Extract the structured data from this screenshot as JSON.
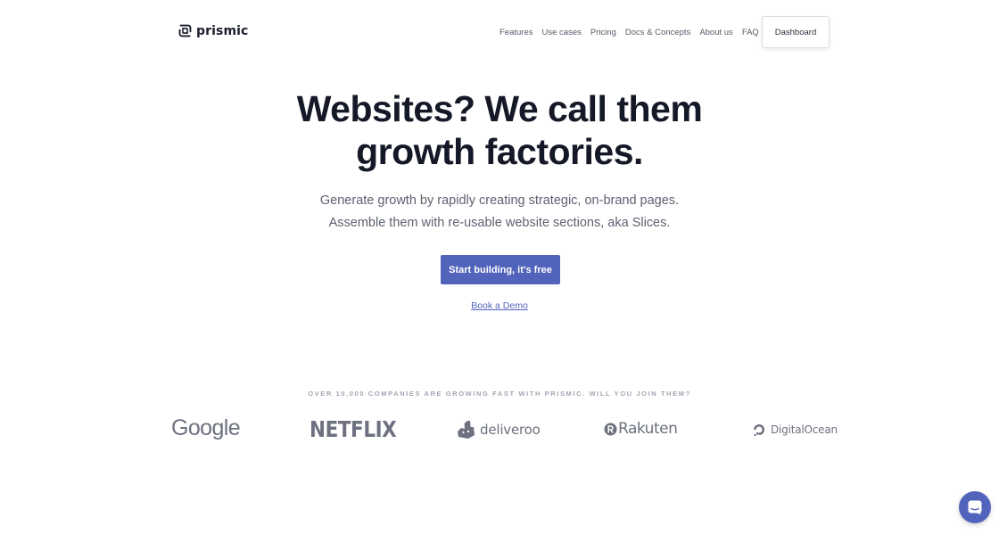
{
  "header": {
    "logo_text": "prismic",
    "nav": [
      {
        "label": "Features"
      },
      {
        "label": "Use cases"
      },
      {
        "label": "Pricing"
      },
      {
        "label": "Docs & Concepts"
      },
      {
        "label": "About us"
      },
      {
        "label": "FAQ"
      }
    ],
    "dashboard_label": "Dashboard"
  },
  "hero": {
    "title_line1": "Websites? We call them",
    "title_line2": "growth factories.",
    "subtitle_line1": "Generate growth by rapidly creating strategic, on-brand pages.",
    "subtitle_line2": "Assemble them with re-usable website sections, aka Slices.",
    "cta_label": "Start building, it's free",
    "demo_label": "Book a Demo"
  },
  "logos": {
    "caption": "OVER 10,000 COMPANIES ARE GROWING FAST WITH PRISMIC. WILL YOU JOIN THEM?",
    "brands": [
      "Google",
      "NETFLIX",
      "deliveroo",
      "Rakuten",
      "DigitalOcean"
    ]
  },
  "colors": {
    "accent": "#5163ba",
    "title": "#151827",
    "body_text": "#5e6270",
    "logo_gray": "#6d7180"
  },
  "icons": {
    "logo": "prismic-logo-icon",
    "deliveroo": "kangaroo-icon",
    "rakuten": "rakuten-r-icon",
    "digitalocean": "digitalocean-drop-icon",
    "chat": "chat-bubble-icon"
  }
}
